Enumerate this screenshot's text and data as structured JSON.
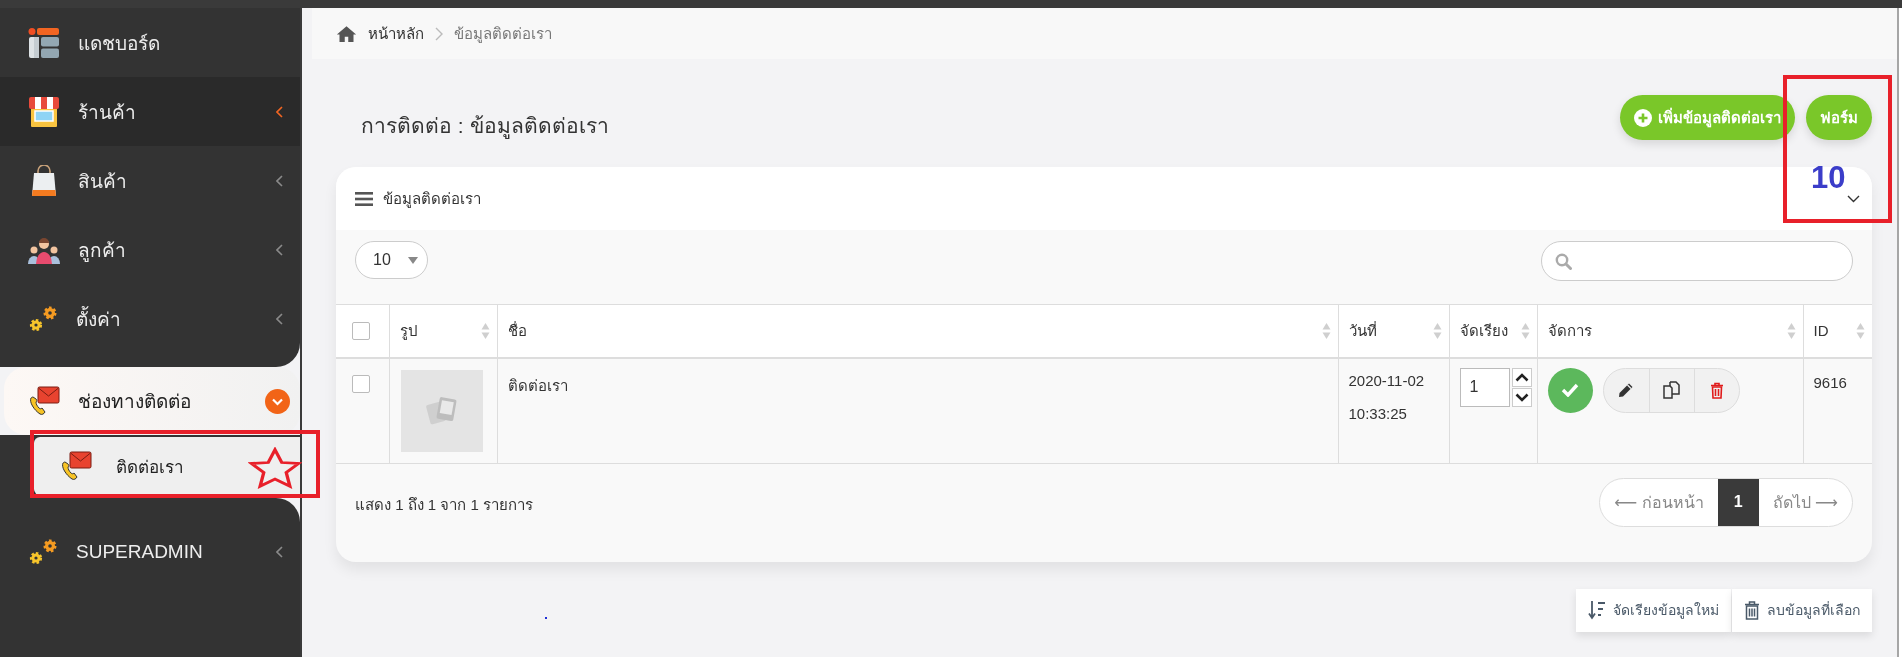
{
  "sidebar": {
    "items": [
      {
        "label": "แดชบอร์ด",
        "kind": "link",
        "highlighted": false,
        "expanded": false
      },
      {
        "label": "ร้านค้า",
        "kind": "menu",
        "highlighted": true,
        "expanded": false
      },
      {
        "label": "สินค้า",
        "kind": "menu",
        "highlighted": false,
        "expanded": false
      },
      {
        "label": "ลูกค้า",
        "kind": "menu",
        "highlighted": false,
        "expanded": false
      },
      {
        "label": "ตั้งค่า",
        "kind": "menu",
        "highlighted": false,
        "expanded": false
      },
      {
        "label": "ช่องทางติดต่อ",
        "kind": "menu",
        "highlighted": false,
        "expanded": true,
        "children": [
          {
            "label": "ติดต่อเรา",
            "selected": true
          }
        ]
      },
      {
        "label": "SUPERADMIN",
        "kind": "menu",
        "highlighted": false,
        "expanded": false
      }
    ]
  },
  "breadcrumb": [
    "หน้าหลัก",
    "ข้อมูลติดต่อเรา"
  ],
  "page_title": "การติดต่อ : ข้อมูลติดต่อเรา",
  "header_buttons": [
    {
      "label": "เพิ่มข้อมูลติดต่อเรา",
      "kind": "add"
    },
    {
      "label": "ฟอร์ม",
      "kind": "plain"
    }
  ],
  "panel": {
    "title": "ข้อมูลติดต่อเรา",
    "page_length": "10"
  },
  "table": {
    "select_all": {
      "checked": false
    },
    "columns": [
      "รูป",
      "ชื่อ",
      "วันที่",
      "จัดเรียง",
      "จัดการ",
      "ID"
    ],
    "rows": [
      {
        "checked": false,
        "name": "ติดต่อเรา",
        "date": "2020-11-02",
        "time": "10:33:25",
        "order": "1",
        "active": true,
        "id": "9616"
      }
    ]
  },
  "footer": {
    "info": "แสดง 1 ถึง 1 จาก 1 รายการ",
    "previous": "⟵ ก่อนหน้า",
    "pages": [
      {
        "label": "1",
        "selected": true
      }
    ],
    "next": "ถัดไป ⟶"
  },
  "bottom_buttons": [
    {
      "label": "จัดเรียงข้อมูลใหม่",
      "kind": "sort"
    },
    {
      "label": "ลบข้อมูลที่เลือก",
      "kind": "delete"
    }
  ],
  "annotations": [
    {
      "kind": "frame"
    },
    {
      "kind": "frame"
    },
    {
      "kind": "star"
    },
    {
      "kind": "text",
      "text": "10"
    }
  ]
}
